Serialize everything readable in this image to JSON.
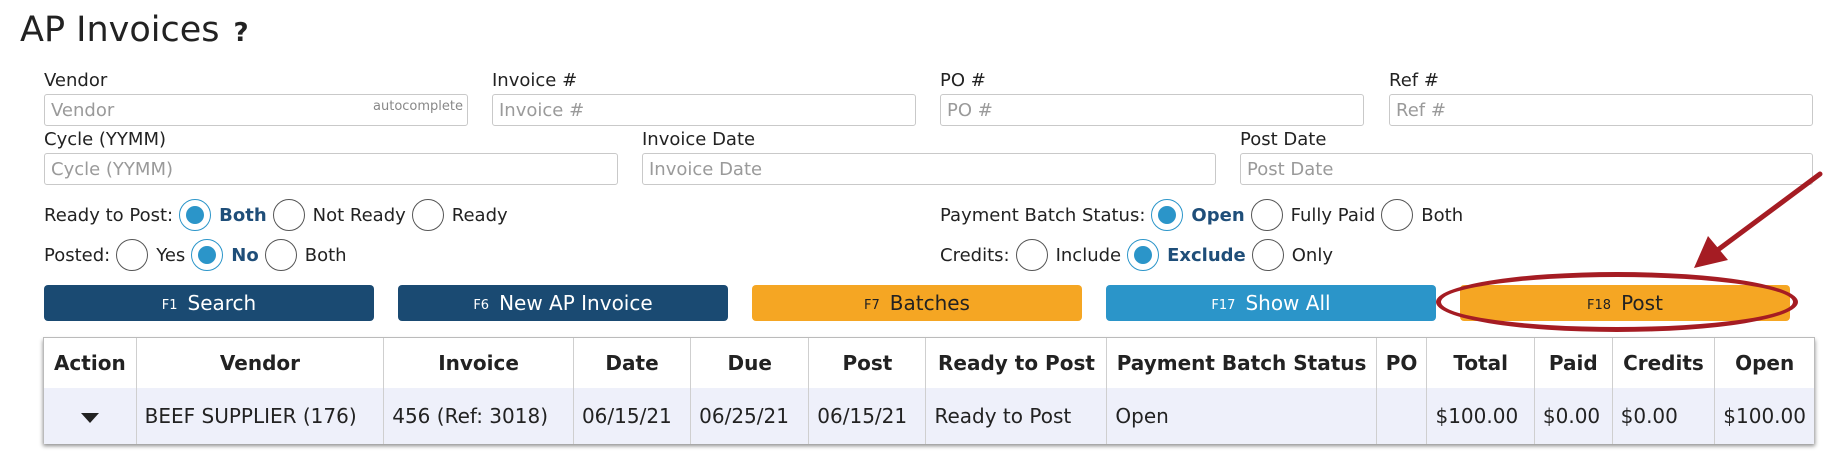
{
  "header": {
    "title": "AP Invoices",
    "help": "?"
  },
  "fields": {
    "vendor": {
      "label": "Vendor",
      "placeholder": "Vendor",
      "hint": "autocomplete"
    },
    "invoice": {
      "label": "Invoice #",
      "placeholder": "Invoice #"
    },
    "po": {
      "label": "PO #",
      "placeholder": "PO #"
    },
    "ref": {
      "label": "Ref #",
      "placeholder": "Ref #"
    },
    "cycle": {
      "label": "Cycle (YYMM)",
      "placeholder": "Cycle (YYMM)"
    },
    "invoice_date": {
      "label": "Invoice Date",
      "placeholder": "Invoice Date"
    },
    "post_date": {
      "label": "Post Date",
      "placeholder": "Post Date"
    }
  },
  "filters": {
    "ready_to_post": {
      "label": "Ready to Post:",
      "options": [
        "Both",
        "Not Ready",
        "Ready"
      ],
      "selected": "Both"
    },
    "posted": {
      "label": "Posted:",
      "options": [
        "Yes",
        "No",
        "Both"
      ],
      "selected": "No"
    },
    "payment_batch_status": {
      "label": "Payment Batch Status:",
      "options": [
        "Open",
        "Fully Paid",
        "Both"
      ],
      "selected": "Open"
    },
    "credits": {
      "label": "Credits:",
      "options": [
        "Include",
        "Exclude",
        "Only"
      ],
      "selected": "Exclude"
    }
  },
  "buttons": {
    "search": {
      "key": "F1",
      "label": "Search"
    },
    "new_invoice": {
      "key": "F6",
      "label": "New AP Invoice"
    },
    "batches": {
      "key": "F7",
      "label": "Batches"
    },
    "show_all": {
      "key": "F17",
      "label": "Show All"
    },
    "post": {
      "key": "F18",
      "label": "Post"
    }
  },
  "colors": {
    "navy": "#1a4a72",
    "orange": "#f5a623",
    "blue": "#2b95c9",
    "annotation": "#a51c23"
  },
  "table": {
    "columns": [
      "Action",
      "Vendor",
      "Invoice",
      "Date",
      "Due",
      "Post",
      "Ready to Post",
      "Payment Batch Status",
      "PO",
      "Total",
      "Paid",
      "Credits",
      "Open"
    ],
    "rows": [
      [
        "",
        "BEEF SUPPLIER (176)",
        "456 (Ref: 3018)",
        "06/15/21",
        "06/25/21",
        "06/15/21",
        "Ready to Post",
        "Open",
        "",
        "$100.00",
        "$0.00",
        "$0.00",
        "$100.00"
      ]
    ]
  }
}
